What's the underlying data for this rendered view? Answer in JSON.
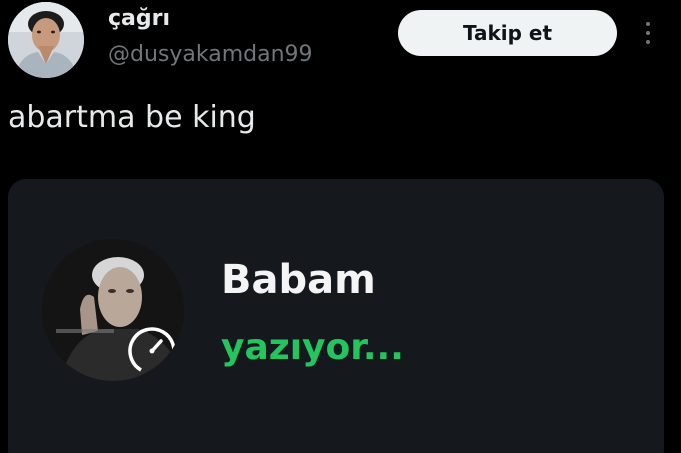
{
  "tweet": {
    "author": {
      "display_name": "çağrı",
      "handle": "@dusyakamdan99"
    },
    "follow_label": "Takip et",
    "more_icon": "more-vertical-icon",
    "text": "abartma be king"
  },
  "media": {
    "contact_name": "Babam",
    "status": "yazıyor...",
    "status_color": "#22c55e",
    "avatar_badge_icon": "timer-icon"
  },
  "colors": {
    "background": "#000000",
    "card": "#15191e",
    "secondary_text": "#71767b",
    "button_bg": "#eff3f4"
  }
}
